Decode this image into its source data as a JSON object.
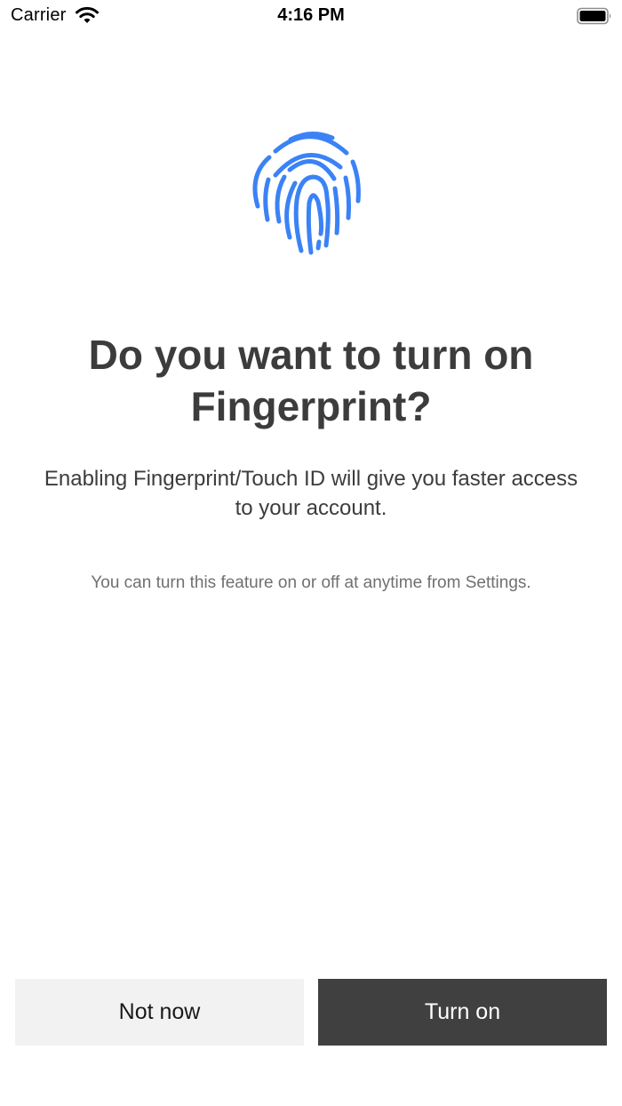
{
  "status_bar": {
    "carrier": "Carrier",
    "time": "4:16 PM",
    "wifi_icon": "wifi-icon",
    "battery_icon": "battery-full-icon"
  },
  "hero": {
    "icon": "fingerprint-icon",
    "icon_color": "#3b82f6"
  },
  "content": {
    "title": "Do you want to turn on Fingerprint?",
    "description": "Enabling Fingerprint/Touch ID will give you faster access to your account.",
    "note": "You can turn this feature on or off at anytime from Settings."
  },
  "actions": {
    "not_now_label": "Not now",
    "turn_on_label": "Turn on"
  },
  "colors": {
    "primary_button": "#404040",
    "secondary_button": "#f2f2f2",
    "text": "#3c3c3c",
    "muted_text": "#707070"
  }
}
